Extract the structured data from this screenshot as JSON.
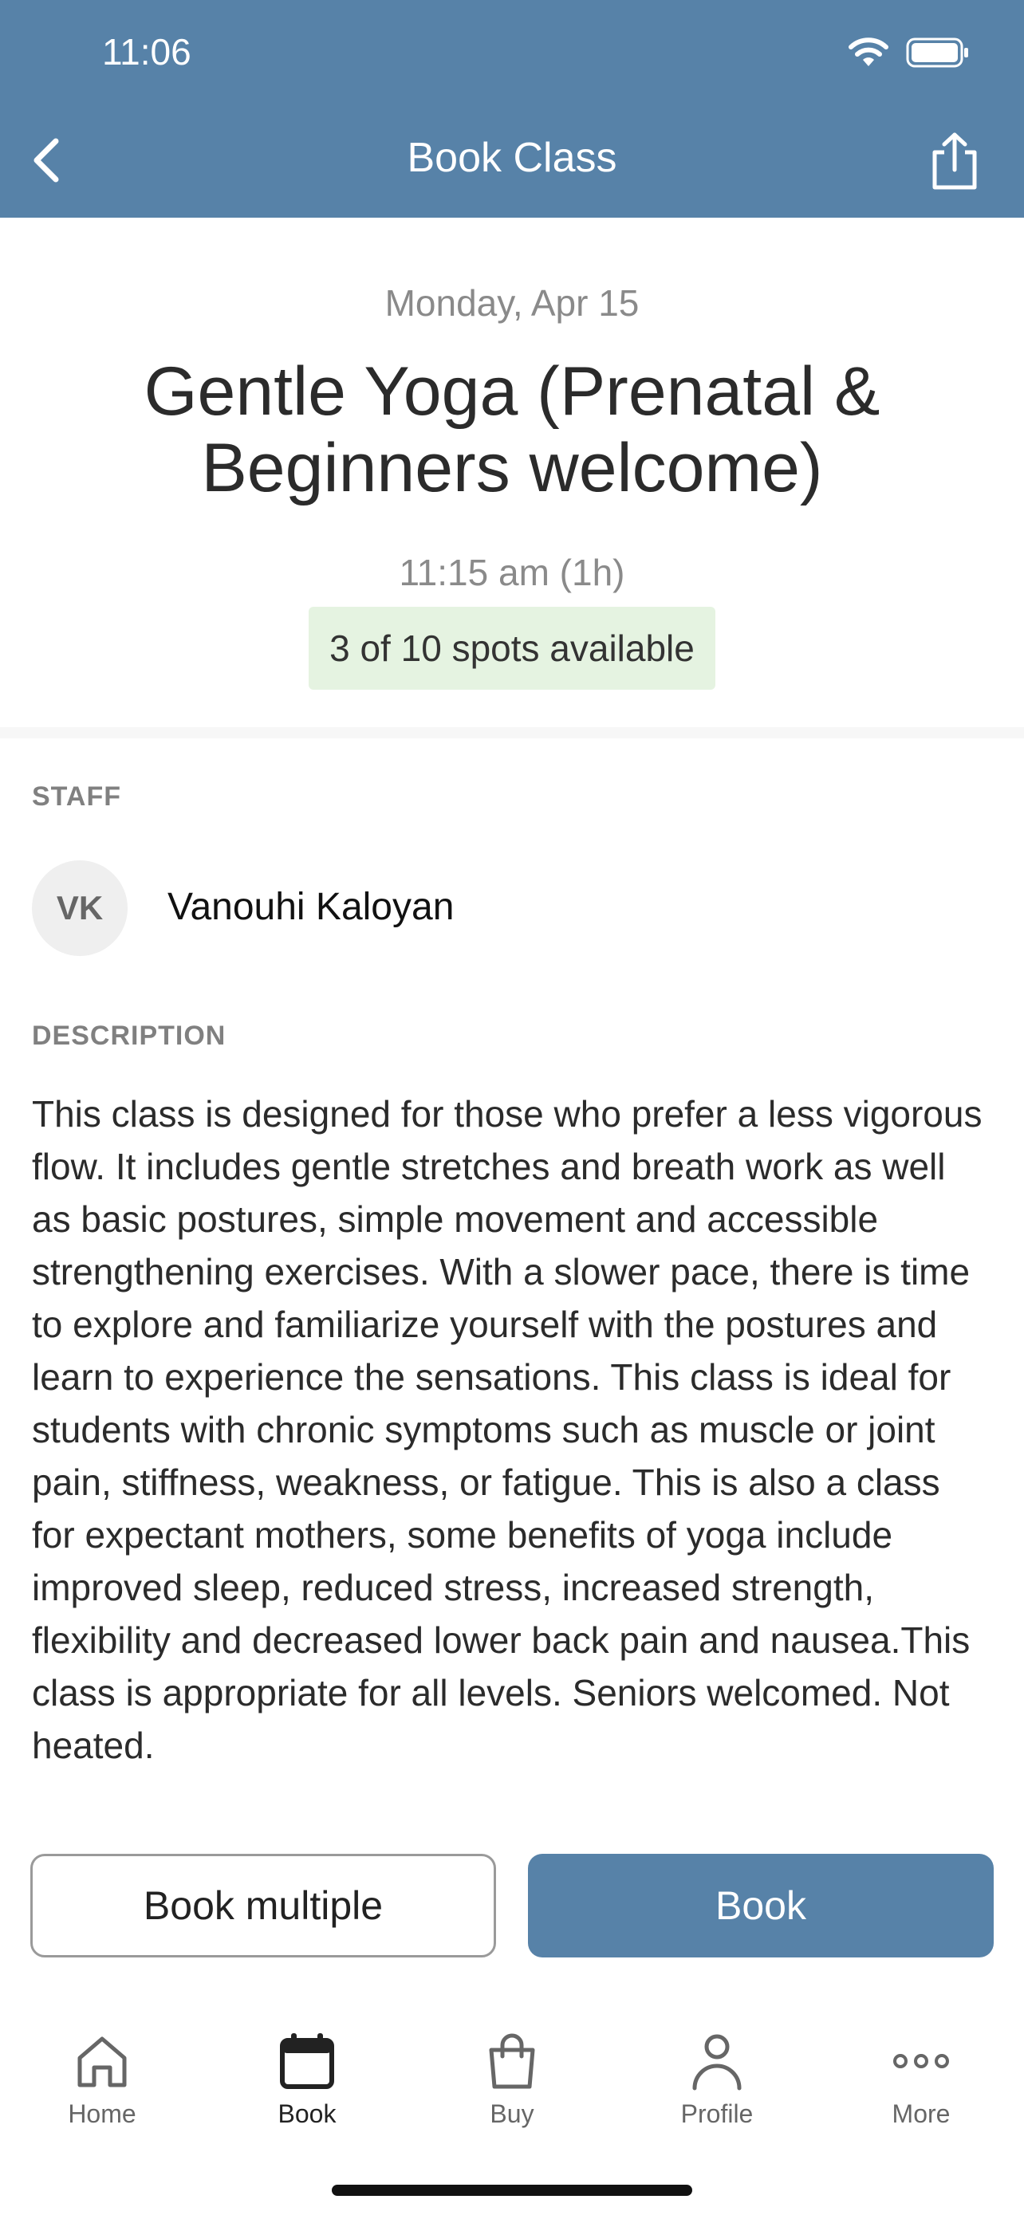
{
  "status_bar": {
    "time": "11:06"
  },
  "nav": {
    "title": "Book Class",
    "back_icon": "chevron-left-icon",
    "share_icon": "share-icon"
  },
  "class": {
    "date": "Monday, Apr 15",
    "title": "Gentle Yoga (Prenatal & Beginners welcome)",
    "time": "11:15 am (1h)",
    "spots": "3 of 10 spots available"
  },
  "staff": {
    "label": "STAFF",
    "initials": "VK",
    "name": "Vanouhi Kaloyan"
  },
  "description": {
    "label": "DESCRIPTION",
    "text": "This class is designed for those who prefer a less vigorous flow. It includes gentle stretches and breath work as well as basic postures, simple movement and accessible strengthening exercises. With a slower pace, there is time to explore and familiarize yourself with the postures and learn to experience the sensations. This class is ideal for students with chronic symptoms such as muscle or joint pain, stiffness, weakness, or fatigue. This is also a class for expectant mothers, some benefits of yoga include improved sleep, reduced stress, increased strength, flexibility and decreased lower back pain and nausea.This class is appropriate for all levels. Seniors welcomed. Not heated."
  },
  "actions": {
    "secondary": "Book multiple",
    "primary": "Book"
  },
  "tabs": [
    {
      "label": "Home",
      "icon": "home-icon"
    },
    {
      "label": "Book",
      "icon": "calendar-icon",
      "active": true
    },
    {
      "label": "Buy",
      "icon": "shopping-bag-icon"
    },
    {
      "label": "Profile",
      "icon": "person-icon"
    },
    {
      "label": "More",
      "icon": "more-icon"
    }
  ],
  "colors": {
    "primary": "#5782a8",
    "badge_bg": "#e5f3e1"
  }
}
